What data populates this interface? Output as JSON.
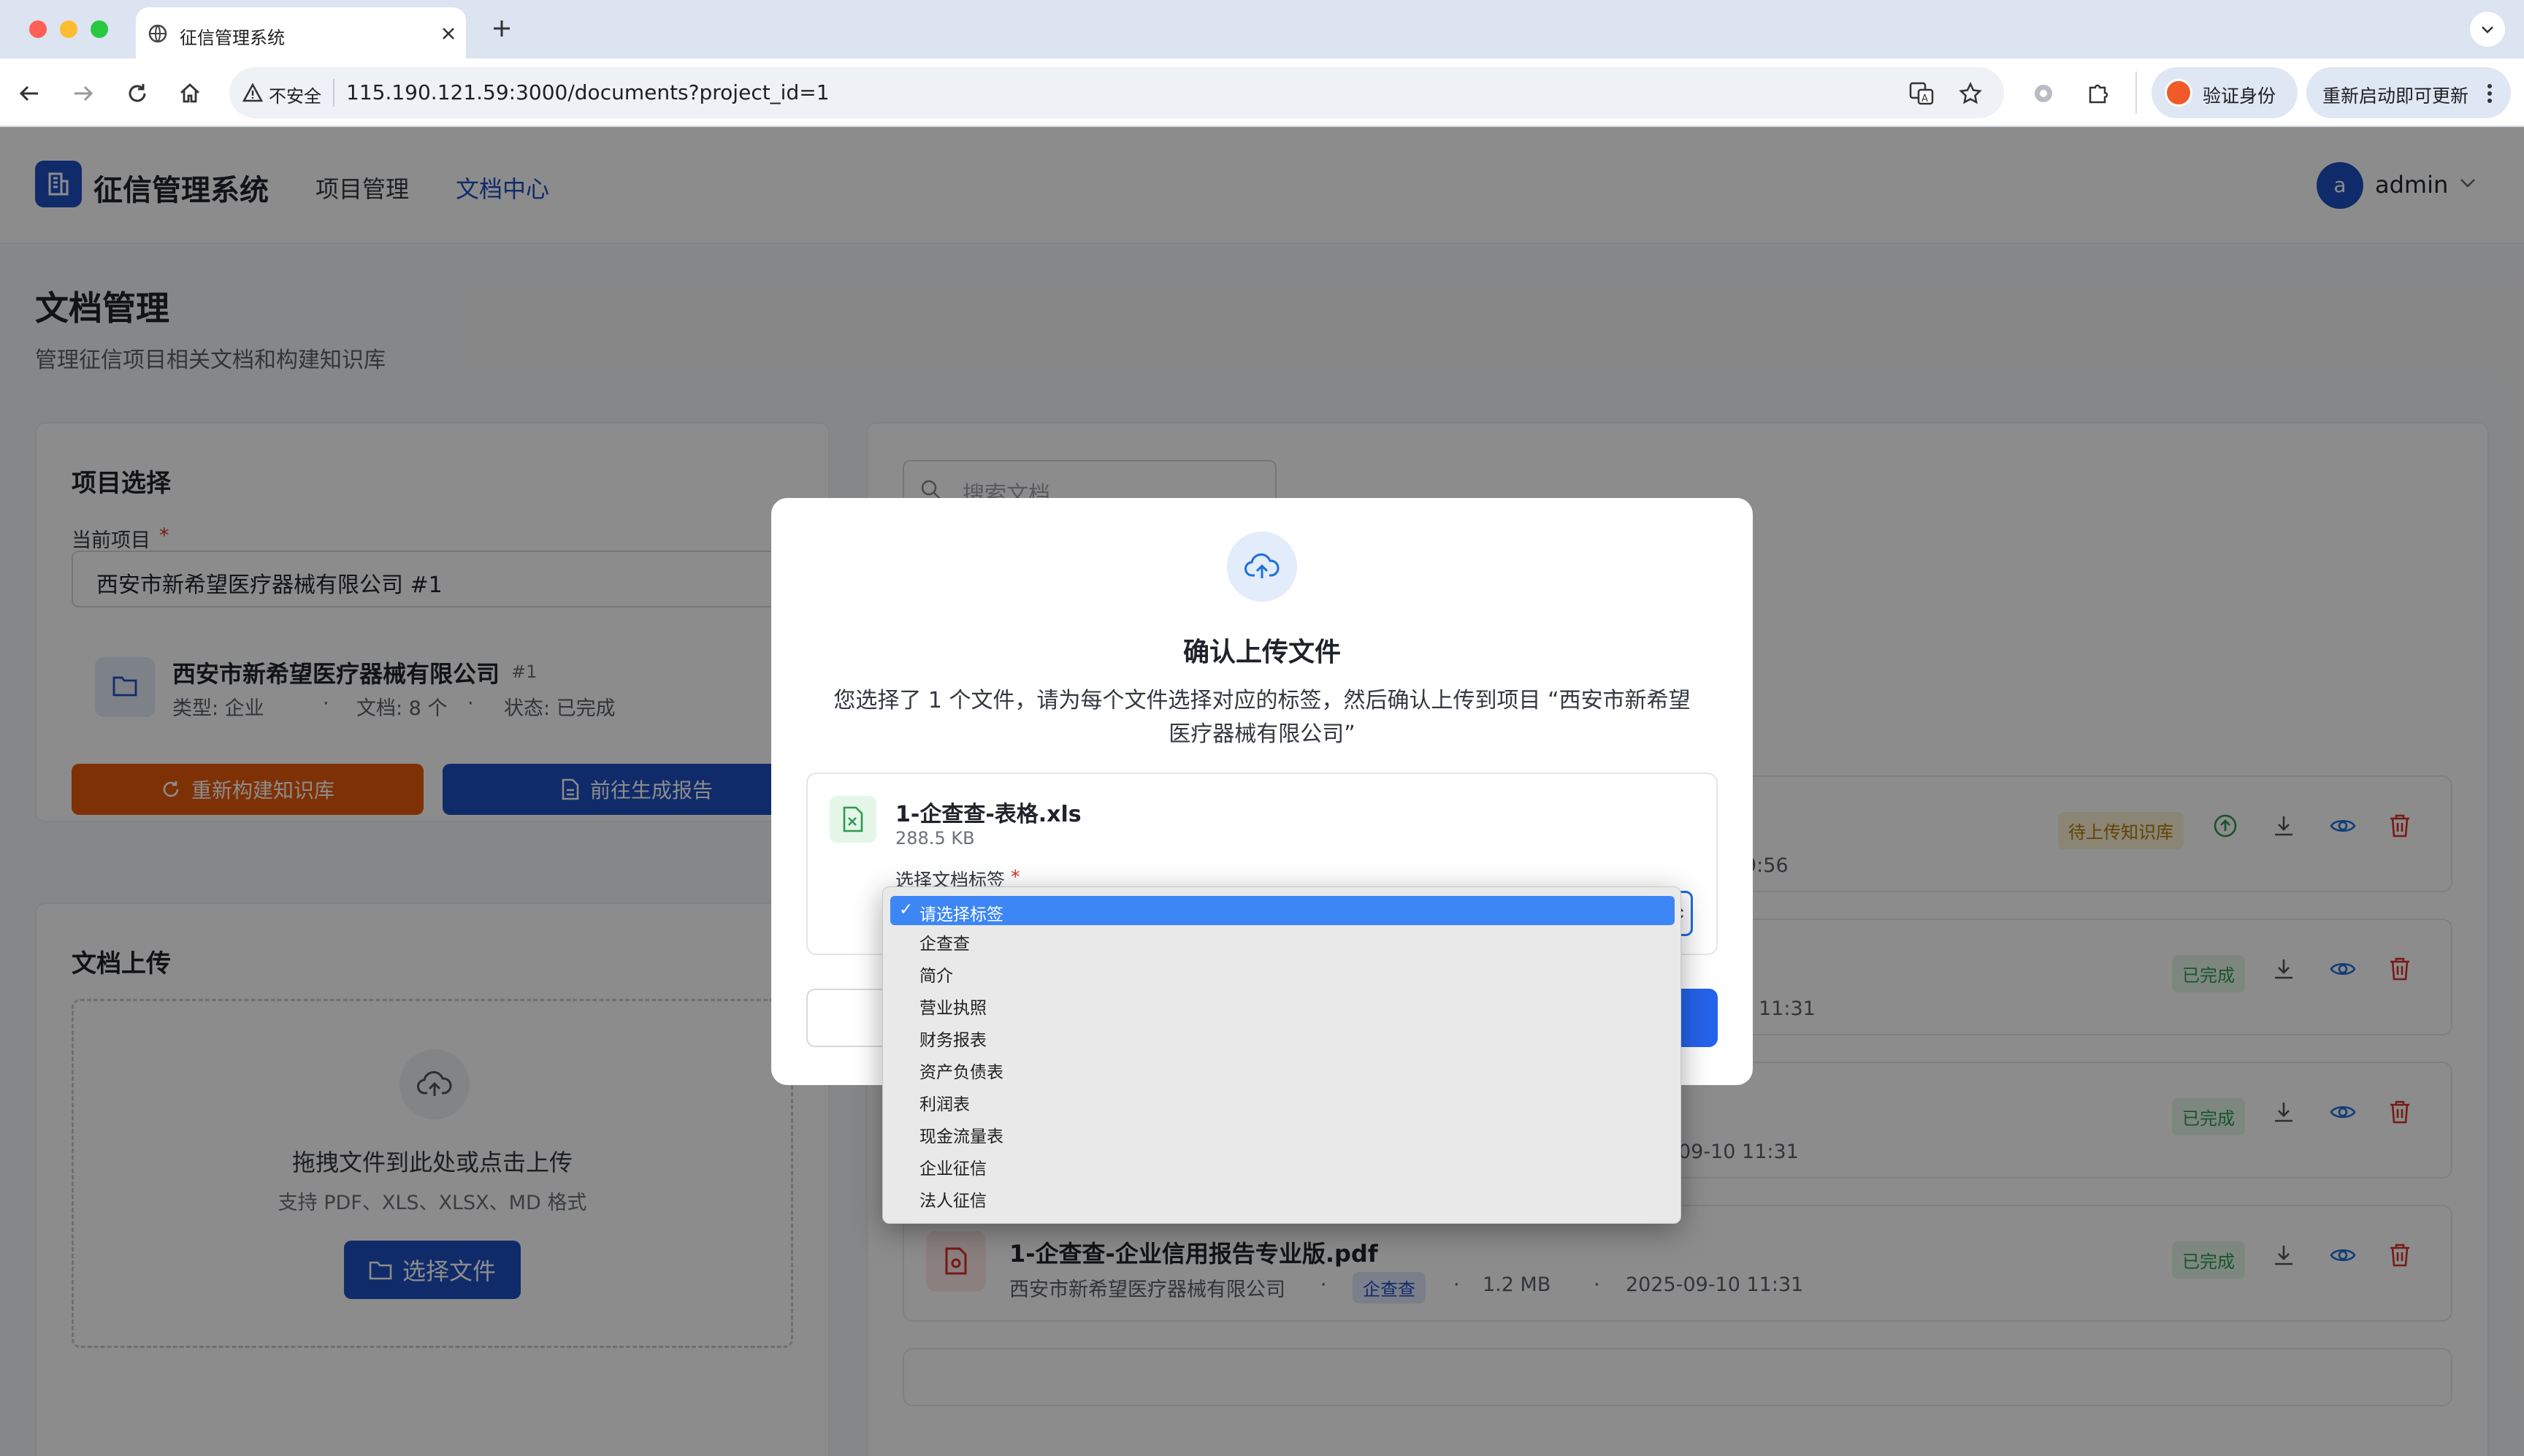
{
  "browser": {
    "tab_title": "征信管理系统",
    "insecure_label": "不安全",
    "url": "115.190.121.59:3000/documents?project_id=1",
    "verify_label": "验证身份",
    "restart_label": "重新启动即可更新"
  },
  "header": {
    "app_title": "征信管理系统",
    "nav": [
      "项目管理",
      "文档中心"
    ],
    "active_nav": "文档中心",
    "avatar_letter": "a",
    "username": "admin"
  },
  "page": {
    "title": "文档管理",
    "subtitle": "管理征信项目相关文档和构建知识库"
  },
  "project_card": {
    "heading": "项目选择",
    "field_label": "当前项目",
    "selected_project": "西安市新希望医疗器械有限公司 #1",
    "project_name": "西安市新希望医疗器械有限公司",
    "project_id": "#1",
    "meta_type": "类型: 企业",
    "meta_docs": "文档: 8 个",
    "meta_status": "状态: 已完成",
    "rebuild_button": "重新构建知识库",
    "report_button": "前往生成报告"
  },
  "upload_card": {
    "heading": "文档上传",
    "drop_text": "拖拽文件到此处或点击上传",
    "formats_text": "支持 PDF、XLS、XLSX、MD 格式",
    "choose_button": "选择文件"
  },
  "documents": {
    "search_placeholder": "搜索文档...",
    "rows": [
      {
        "time_fragment": "9:56",
        "status": "待上传知识库"
      },
      {
        "time_fragment": "11:31",
        "status": "已完成"
      },
      {
        "time_fragment": "09-10 11:31",
        "status": "已完成"
      },
      {
        "name": "1-企查查-企业信用报告专业版.pdf",
        "company": "西安市新希望医疗器械有限公司",
        "tag": "企查查",
        "size": "1.2 MB",
        "time": "2025-09-10 11:31",
        "status": "已完成"
      }
    ]
  },
  "modal": {
    "title": "确认上传文件",
    "description_line1": "您选择了 1 个文件，请为每个文件选择对应的标签，然后确认上传到项目 “西安市新希望",
    "description_line2": "医疗器械有限公司”",
    "file_name": "1-企查查-表格.xls",
    "file_size": "288.5 KB",
    "tag_label": "选择文档标签"
  },
  "dropdown": {
    "selected": "请选择标签",
    "options": [
      "企查查",
      "简介",
      "营业执照",
      "财务报表",
      "资产负债表",
      "利润表",
      "现金流量表",
      "企业征信",
      "法人征信"
    ]
  }
}
